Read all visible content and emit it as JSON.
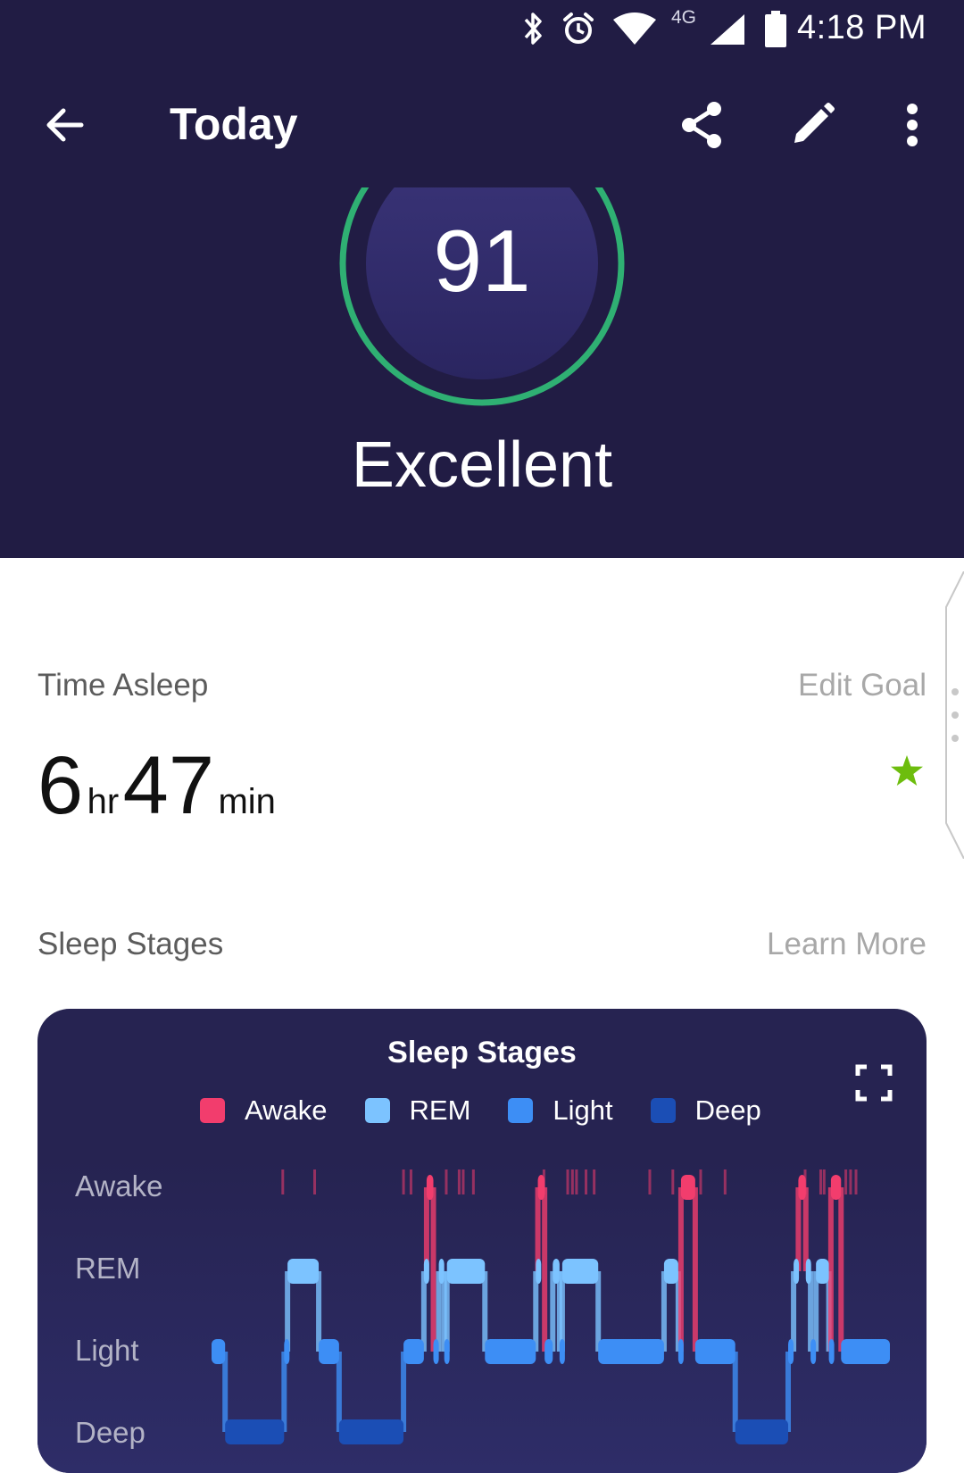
{
  "status_bar": {
    "time": "4:18 PM",
    "network": "4G",
    "icons": [
      "bluetooth-icon",
      "alarm-icon",
      "wifi-icon",
      "signal-icon",
      "battery-icon"
    ]
  },
  "toolbar": {
    "title": "Today",
    "icons": [
      "back-arrow-icon",
      "share-icon",
      "edit-pencil-icon",
      "more-vert-icon"
    ]
  },
  "score": {
    "value": "91",
    "rating": "Excellent",
    "ring_color": "#2fb073"
  },
  "time_asleep": {
    "label": "Time Asleep",
    "edit_link": "Edit Goal",
    "hours": "6",
    "hours_unit": "hr",
    "minutes": "47",
    "minutes_unit": "min",
    "goal_met_icon": "star-icon",
    "star_color": "#6dbd0d"
  },
  "sleep_stages": {
    "label": "Sleep Stages",
    "learn_link": "Learn More"
  },
  "chart_data": {
    "type": "step",
    "title": "Sleep Stages",
    "legend": [
      {
        "name": "Awake",
        "color": "#f23d6d"
      },
      {
        "name": "REM",
        "color": "#7cc3ff"
      },
      {
        "name": "Light",
        "color": "#3d8ef5"
      },
      {
        "name": "Deep",
        "color": "#1b4eb5"
      }
    ],
    "y_levels": [
      "Awake",
      "REM",
      "Light",
      "Deep"
    ],
    "segments": [
      {
        "stage": "Light",
        "start": 0.0,
        "end": 0.02
      },
      {
        "stage": "Deep",
        "start": 0.02,
        "end": 0.107
      },
      {
        "stage": "Light",
        "start": 0.107,
        "end": 0.112
      },
      {
        "stage": "REM",
        "start": 0.112,
        "end": 0.158
      },
      {
        "stage": "Light",
        "start": 0.158,
        "end": 0.188
      },
      {
        "stage": "Deep",
        "start": 0.188,
        "end": 0.283
      },
      {
        "stage": "Light",
        "start": 0.283,
        "end": 0.313
      },
      {
        "stage": "REM",
        "start": 0.313,
        "end": 0.317
      },
      {
        "stage": "Awake",
        "start": 0.317,
        "end": 0.327
      },
      {
        "stage": "Light",
        "start": 0.327,
        "end": 0.335
      },
      {
        "stage": "REM",
        "start": 0.335,
        "end": 0.343
      },
      {
        "stage": "Light",
        "start": 0.343,
        "end": 0.347
      },
      {
        "stage": "REM",
        "start": 0.347,
        "end": 0.403
      },
      {
        "stage": "Light",
        "start": 0.403,
        "end": 0.478
      },
      {
        "stage": "REM",
        "start": 0.478,
        "end": 0.481
      },
      {
        "stage": "Awake",
        "start": 0.481,
        "end": 0.491
      },
      {
        "stage": "Light",
        "start": 0.491,
        "end": 0.503
      },
      {
        "stage": "REM",
        "start": 0.503,
        "end": 0.513
      },
      {
        "stage": "Light",
        "start": 0.513,
        "end": 0.517
      },
      {
        "stage": "REM",
        "start": 0.517,
        "end": 0.57
      },
      {
        "stage": "Light",
        "start": 0.57,
        "end": 0.667
      },
      {
        "stage": "REM",
        "start": 0.667,
        "end": 0.688
      },
      {
        "stage": "Light",
        "start": 0.688,
        "end": 0.692
      },
      {
        "stage": "Awake",
        "start": 0.692,
        "end": 0.713
      },
      {
        "stage": "Light",
        "start": 0.713,
        "end": 0.772
      },
      {
        "stage": "Deep",
        "start": 0.772,
        "end": 0.85
      },
      {
        "stage": "Light",
        "start": 0.85,
        "end": 0.858
      },
      {
        "stage": "REM",
        "start": 0.858,
        "end": 0.865
      },
      {
        "stage": "Awake",
        "start": 0.865,
        "end": 0.876
      },
      {
        "stage": "REM",
        "start": 0.876,
        "end": 0.883
      },
      {
        "stage": "Light",
        "start": 0.883,
        "end": 0.891
      },
      {
        "stage": "REM",
        "start": 0.891,
        "end": 0.91
      },
      {
        "stage": "Light",
        "start": 0.91,
        "end": 0.913
      },
      {
        "stage": "Awake",
        "start": 0.913,
        "end": 0.928
      },
      {
        "stage": "Light",
        "start": 0.928,
        "end": 1.0
      }
    ],
    "brief_wakes": [
      0.105,
      0.152,
      0.283,
      0.294,
      0.346,
      0.365,
      0.371,
      0.386,
      0.49,
      0.525,
      0.532,
      0.538,
      0.552,
      0.564,
      0.646,
      0.68,
      0.721,
      0.757,
      0.875,
      0.898,
      0.903,
      0.935,
      0.942,
      0.95
    ]
  }
}
